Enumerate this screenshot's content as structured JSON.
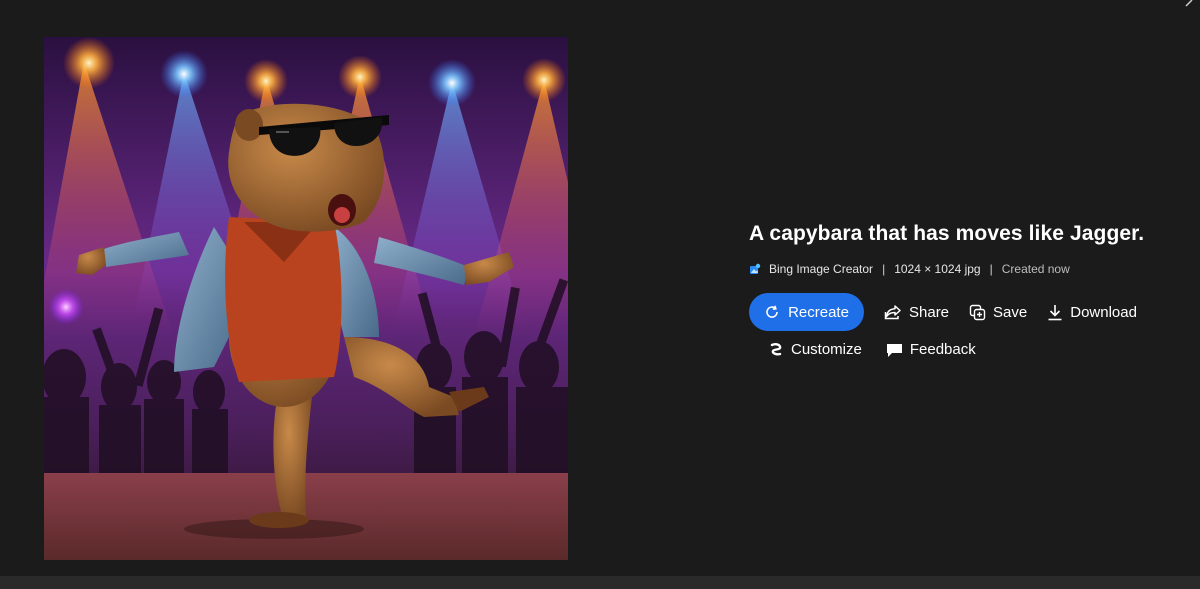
{
  "image": {
    "alt_label": "capybara-dancing-image",
    "colors": {
      "stage_top": "#2a1040",
      "stage_mid": "#8a2f9c",
      "spot_warm": "#ff8a2a",
      "spot_cool": "#5fb0ff",
      "floor": "#7a3a3a"
    }
  },
  "info": {
    "title": "A capybara that has moves like Jagger.",
    "source": "Bing Image Creator",
    "separator": "|",
    "dimensions": "1024 × 1024 jpg",
    "created": "Created now"
  },
  "actions": {
    "recreate": "Recreate",
    "share": "Share",
    "save": "Save",
    "download": "Download",
    "customize": "Customize",
    "feedback": "Feedback"
  },
  "colors": {
    "background": "#1b1b1b",
    "accent": "#1f6fe8",
    "text": "#ffffff"
  }
}
